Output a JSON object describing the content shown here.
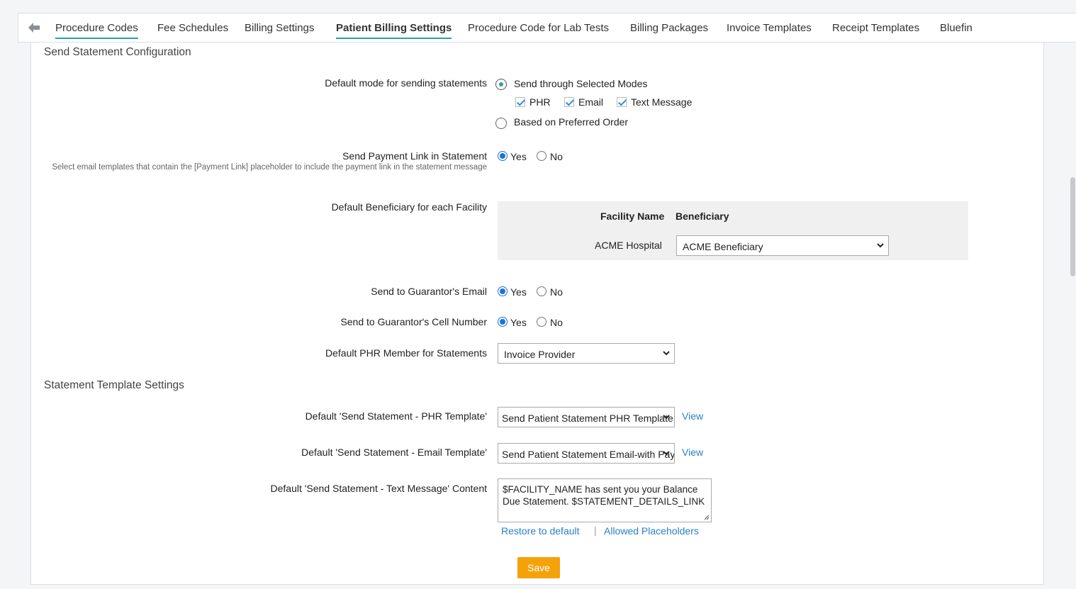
{
  "tabs": [
    {
      "label": "Procedure Codes"
    },
    {
      "label": "Fee Schedules"
    },
    {
      "label": "Billing Settings"
    },
    {
      "label": "Patient Billing Settings",
      "active": true
    },
    {
      "label": "Procedure Code for Lab Tests"
    },
    {
      "label": "Billing Packages"
    },
    {
      "label": "Invoice Templates"
    },
    {
      "label": "Receipt Templates"
    },
    {
      "label": "Bluefin"
    }
  ],
  "send_statement": {
    "title": "Send Statement Configuration",
    "default_mode": {
      "label": "Default mode for sending statements",
      "option_selected_modes": "Send through Selected Modes",
      "selected": "Send through Selected Modes",
      "modes": [
        {
          "label": "PHR",
          "checked": true
        },
        {
          "label": "Email",
          "checked": true
        },
        {
          "label": "Text Message",
          "checked": true
        }
      ],
      "option_preferred": "Based on Preferred Order"
    },
    "payment_link": {
      "label": "Send Payment Link in Statement",
      "hint": "Select email templates that contain the [Payment Link] placeholder to include the payment link in the statement message",
      "yes": "Yes",
      "no": "No",
      "value": "Yes"
    },
    "beneficiary": {
      "label": "Default Beneficiary for each Facility",
      "col_facility": "Facility Name",
      "col_beneficiary": "Beneficiary",
      "rows": [
        {
          "facility": "ACME Hospital",
          "beneficiary": "ACME Beneficiary"
        }
      ]
    },
    "guarantor_email": {
      "label": "Send to Guarantor's Email",
      "yes": "Yes",
      "no": "No",
      "value": "Yes"
    },
    "guarantor_cell": {
      "label": "Send to Guarantor's Cell Number",
      "yes": "Yes",
      "no": "No",
      "value": "Yes"
    },
    "phr_member": {
      "label": "Default PHR Member for Statements",
      "value": "Invoice Provider"
    }
  },
  "template_settings": {
    "title": "Statement Template Settings",
    "phr_template": {
      "label": "Default 'Send Statement - PHR Template'",
      "value": "Send Patient Statement PHR Template",
      "view": "View"
    },
    "email_template": {
      "label": "Default 'Send Statement - Email Template'",
      "value": "Send Patient Statement Email-with Payment Link",
      "view": "View"
    },
    "text_message": {
      "label": "Default 'Send Statement - Text Message' Content",
      "value": "$FACILITY_NAME has sent you your Balance Due Statement. $STATEMENT_DETAILS_LINK",
      "restore": "Restore to default",
      "separator": "|",
      "placeholders": "Allowed Placeholders"
    }
  },
  "save_label": "Save",
  "colors": {
    "accent_teal": "#2aa3a0",
    "radio_blue": "#1a73d9",
    "link": "#2a80c8",
    "save": "#f5a20a"
  }
}
